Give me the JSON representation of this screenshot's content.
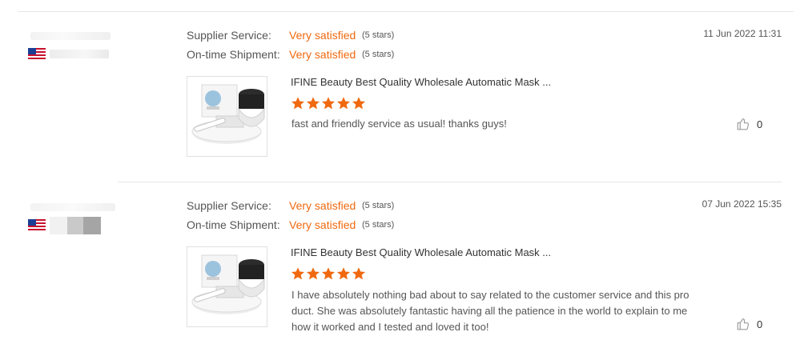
{
  "reviews": [
    {
      "supplier_label": "Supplier Service:",
      "supplier_rating": "Very satisfied",
      "supplier_stars": "(5 stars)",
      "shipment_label": "On-time Shipment:",
      "shipment_rating": "Very satisfied",
      "shipment_stars": "(5 stars)",
      "date": "11 Jun 2022 11:31",
      "product_title": "IFINE Beauty Best Quality Wholesale Automatic Mask ...",
      "stars": 5,
      "text": "fast and friendly service as usual! thanks guys!",
      "likes": "0"
    },
    {
      "supplier_label": "Supplier Service:",
      "supplier_rating": "Very satisfied",
      "supplier_stars": "(5 stars)",
      "shipment_label": "On-time Shipment:",
      "shipment_rating": "Very satisfied",
      "shipment_stars": "(5 stars)",
      "date": "07 Jun 2022 15:35",
      "product_title": "IFINE Beauty Best Quality Wholesale Automatic Mask ...",
      "stars": 5,
      "text": "I have absolutely nothing bad about to say related to the customer service and this product. She was absolutely fantastic having all the patience in the world to explain to me how it worked and I tested and loved it too!",
      "likes": "0"
    }
  ],
  "colors": {
    "accent": "#f0690f",
    "star": "#f0690f",
    "divider": "#e6e6e6"
  },
  "icons": {
    "flag": "us-flag-icon",
    "star": "star-icon",
    "like": "thumbs-up-icon"
  }
}
